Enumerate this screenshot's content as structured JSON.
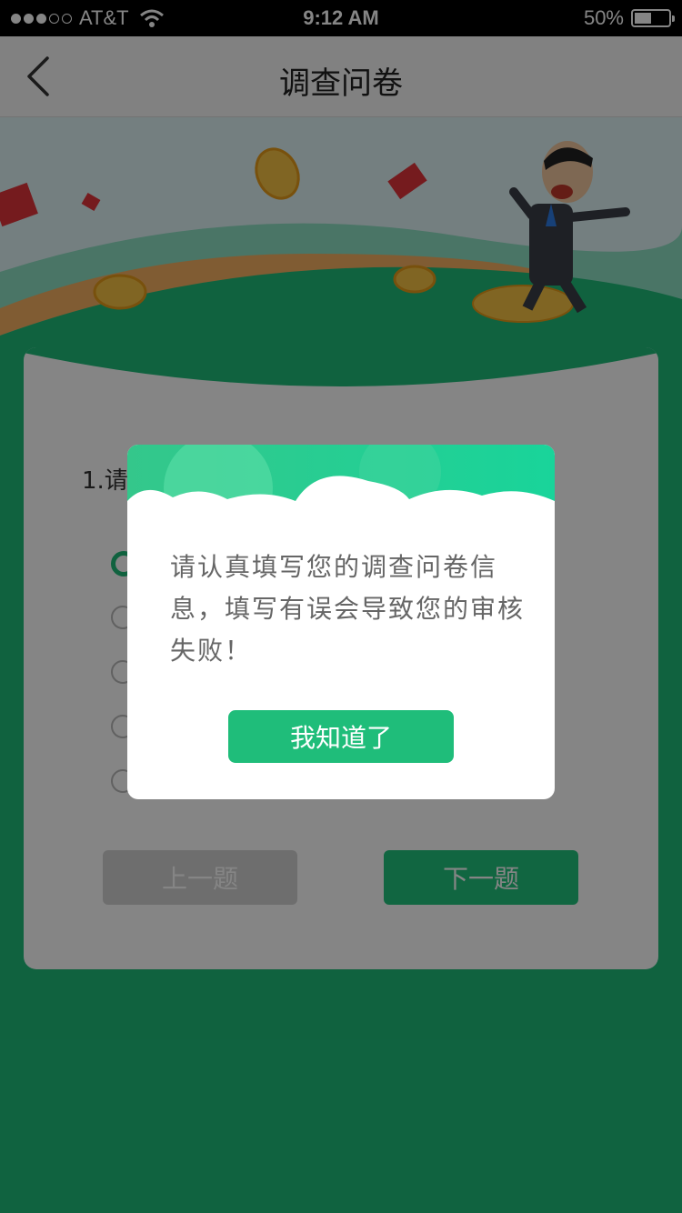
{
  "status_bar": {
    "carrier": "AT&T",
    "time": "9:12 AM",
    "battery": "50%",
    "battery_level": 0.5,
    "signal_icon": "signal-dots-icon",
    "wifi_icon": "wifi-icon"
  },
  "navbar": {
    "back_icon": "chevron-left-icon",
    "title": "调查问卷"
  },
  "question": {
    "text": "1.请"
  },
  "buttons": {
    "prev": "上一题",
    "next": "下一题"
  },
  "modal": {
    "message": "请认真填写您的调查问卷信息，填写有误会导致您的审核失败！",
    "confirm": "我知道了"
  },
  "colors": {
    "brand_green": "#1fbd7a",
    "disabled_gray": "#d3d3d3"
  }
}
